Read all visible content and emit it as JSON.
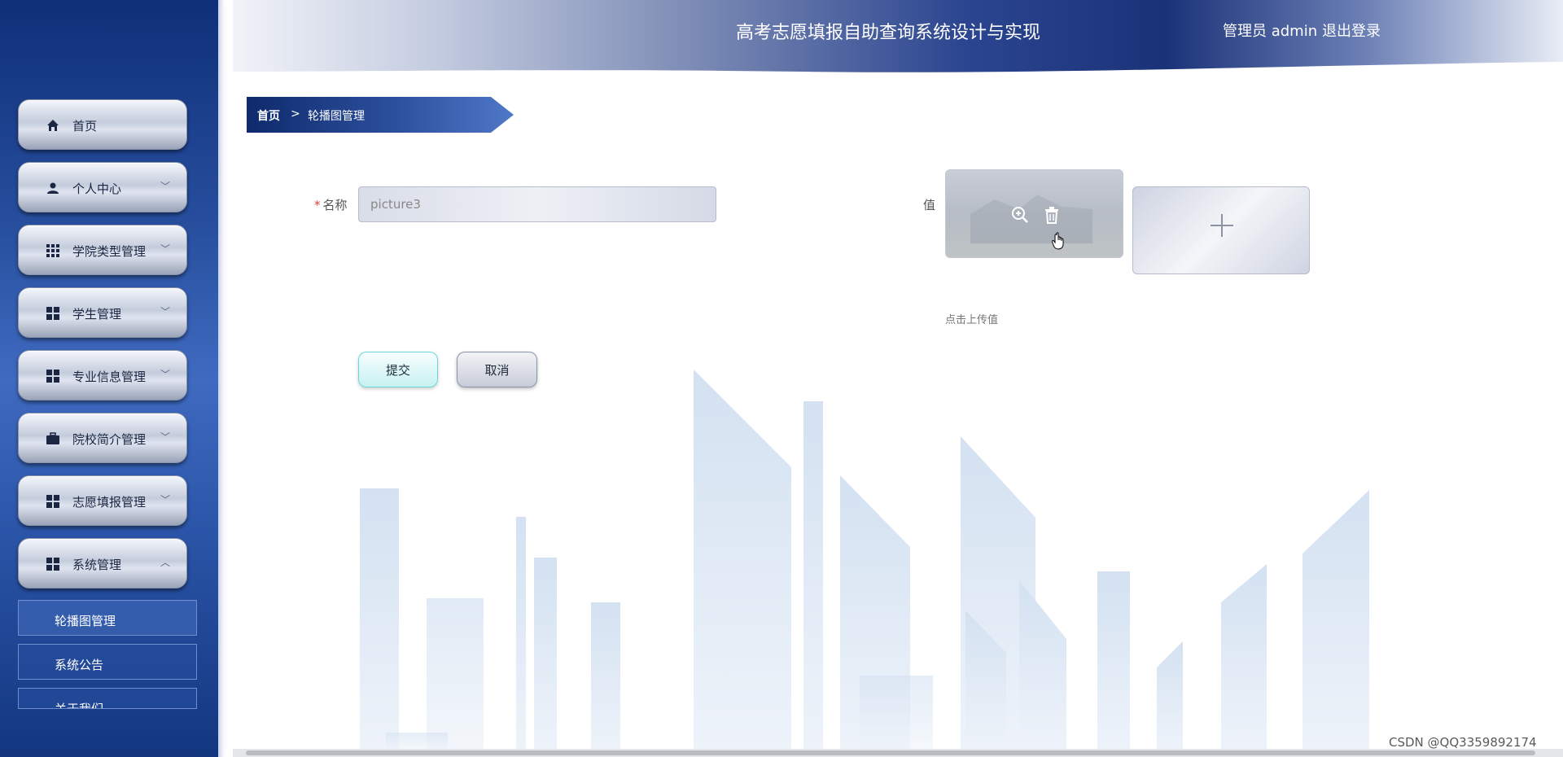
{
  "header": {
    "title": "高考志愿填报自助查询系统设计与实现",
    "user_label": "管理员 admin",
    "logout": "退出登录"
  },
  "sidebar": {
    "items": [
      {
        "label": "首页",
        "icon": "home-icon",
        "expanded": null
      },
      {
        "label": "个人中心",
        "icon": "user-icon",
        "expanded": false
      },
      {
        "label": "学院类型管理",
        "icon": "grid-icon",
        "expanded": false
      },
      {
        "label": "学生管理",
        "icon": "grid-icon",
        "expanded": false
      },
      {
        "label": "专业信息管理",
        "icon": "grid-icon",
        "expanded": false
      },
      {
        "label": "院校简介管理",
        "icon": "briefcase-icon",
        "expanded": false
      },
      {
        "label": "志愿填报管理",
        "icon": "grid-icon",
        "expanded": false
      },
      {
        "label": "系统管理",
        "icon": "grid-icon",
        "expanded": true
      }
    ],
    "submenu": [
      {
        "label": "轮播图管理",
        "active": true
      },
      {
        "label": "系统公告",
        "active": false
      },
      {
        "label": "关于我们",
        "active": false
      }
    ]
  },
  "breadcrumb": {
    "home": "首页",
    "separator": ">",
    "current": "轮播图管理"
  },
  "form": {
    "name_label": "名称",
    "name_value": "picture3",
    "value_label": "值",
    "upload_hint": "点击上传值",
    "submit": "提交",
    "cancel": "取消"
  },
  "watermark": "CSDN @QQ3359892174",
  "colors": {
    "sidebar_dark": "#0f2f78",
    "sidebar_mid": "#3f6ac0",
    "header_accent": "#1a3278",
    "submit_border": "#6fd7d8",
    "required_mark": "#e04040"
  }
}
